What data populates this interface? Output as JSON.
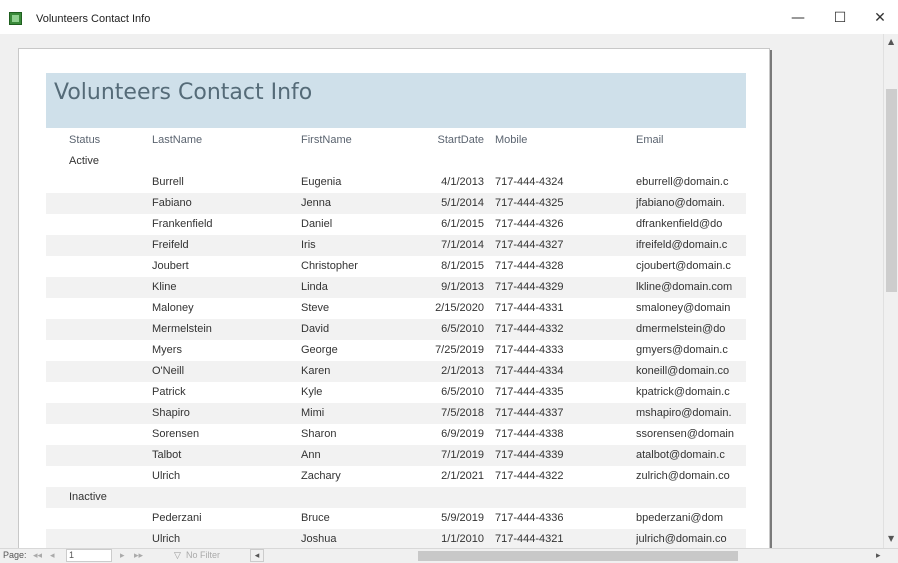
{
  "window": {
    "title": "Volunteers Contact Info",
    "controls": {
      "minimize": "—",
      "maximize": "☐",
      "close": "✕"
    }
  },
  "report": {
    "title": "Volunteers Contact Info",
    "columns": {
      "status": "Status",
      "lastname": "LastName",
      "firstname": "FirstName",
      "startdate": "StartDate",
      "mobile": "Mobile",
      "email": "Email"
    },
    "groups": [
      {
        "label": "Active",
        "rows": [
          {
            "last": "Burrell",
            "first": "Eugenia",
            "start": "4/1/2013",
            "mobile": "717-444-4324",
            "email": "eburrell@domain.c"
          },
          {
            "last": "Fabiano",
            "first": "Jenna",
            "start": "5/1/2014",
            "mobile": "717-444-4325",
            "email": "jfabiano@domain."
          },
          {
            "last": "Frankenfield",
            "first": "Daniel",
            "start": "6/1/2015",
            "mobile": "717-444-4326",
            "email": "dfrankenfield@do"
          },
          {
            "last": "Freifeld",
            "first": "Iris",
            "start": "7/1/2014",
            "mobile": "717-444-4327",
            "email": "ifreifeld@domain.c"
          },
          {
            "last": "Joubert",
            "first": "Christopher",
            "start": "8/1/2015",
            "mobile": "717-444-4328",
            "email": "cjoubert@domain.c"
          },
          {
            "last": "Kline",
            "first": "Linda",
            "start": "9/1/2013",
            "mobile": "717-444-4329",
            "email": "lkline@domain.com"
          },
          {
            "last": "Maloney",
            "first": "Steve",
            "start": "2/15/2020",
            "mobile": "717-444-4331",
            "email": "smaloney@domain"
          },
          {
            "last": "Mermelstein",
            "first": "David",
            "start": "6/5/2010",
            "mobile": "717-444-4332",
            "email": "dmermelstein@do"
          },
          {
            "last": "Myers",
            "first": "George",
            "start": "7/25/2019",
            "mobile": "717-444-4333",
            "email": "gmyers@domain.c"
          },
          {
            "last": "O'Neill",
            "first": "Karen",
            "start": "2/1/2013",
            "mobile": "717-444-4334",
            "email": "koneill@domain.co"
          },
          {
            "last": "Patrick",
            "first": "Kyle",
            "start": "6/5/2010",
            "mobile": "717-444-4335",
            "email": "kpatrick@domain.c"
          },
          {
            "last": "Shapiro",
            "first": "Mimi",
            "start": "7/5/2018",
            "mobile": "717-444-4337",
            "email": "mshapiro@domain."
          },
          {
            "last": "Sorensen",
            "first": "Sharon",
            "start": "6/9/2019",
            "mobile": "717-444-4338",
            "email": "ssorensen@domain"
          },
          {
            "last": "Talbot",
            "first": "Ann",
            "start": "7/1/2019",
            "mobile": "717-444-4339",
            "email": "atalbot@domain.c"
          },
          {
            "last": "Ulrich",
            "first": "Zachary",
            "start": "2/1/2021",
            "mobile": "717-444-4322",
            "email": "zulrich@domain.co"
          }
        ]
      },
      {
        "label": "Inactive",
        "rows": [
          {
            "last": "Pederzani",
            "first": "Bruce",
            "start": "5/9/2019",
            "mobile": "717-444-4336",
            "email": "bpederzani@dom"
          },
          {
            "last": "Ulrich",
            "first": "Joshua",
            "start": "1/1/2010",
            "mobile": "717-444-4321",
            "email": "julrich@domain.co"
          }
        ]
      }
    ]
  },
  "statusbar": {
    "page_label": "Page:",
    "page_number": "1",
    "filter_label": "No Filter",
    "nav_first": "◂◂",
    "nav_prev": "◂",
    "nav_next": "▸",
    "nav_last": "▸▸"
  },
  "colors": {
    "title_band": "#cfe0ea",
    "title_text": "#556b78",
    "alt_row": "#f2f2f2"
  },
  "icons": [
    "app-icon",
    "minimize-icon",
    "maximize-icon",
    "close-icon",
    "filter-icon"
  ]
}
